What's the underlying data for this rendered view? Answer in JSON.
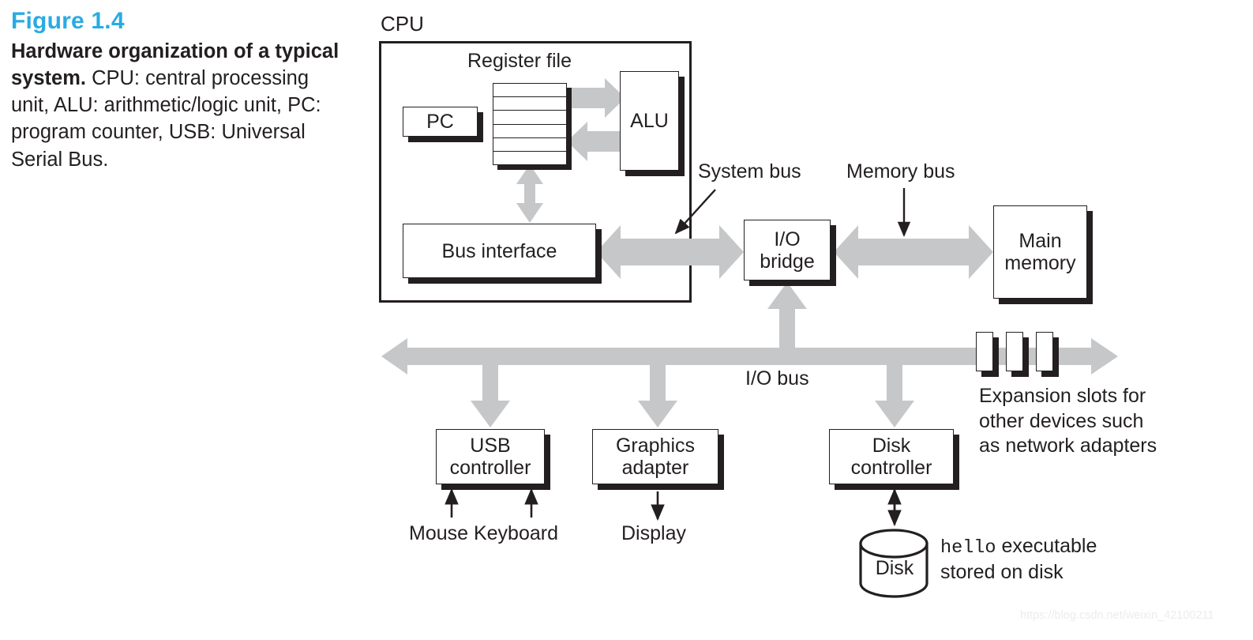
{
  "caption": {
    "figure_number": "Figure 1.4",
    "title": "Hardware organization of a typical system.",
    "title_line1": "Hardware organization",
    "title_line2": "of a typical system.",
    "body_rest": " CPU: central processing unit, ALU: arithmetic/logic unit, PC: program counter, USB: Universal Serial Bus.",
    "accent_color": "#29ABE2",
    "text_color": "#231f20"
  },
  "diagram": {
    "cpu_label": "CPU",
    "register_file_label": "Register file",
    "register_file_rows": 6,
    "blocks": {
      "pc": "PC",
      "alu": "ALU",
      "bus_interface": "Bus interface",
      "io_bridge_line1": "I/O",
      "io_bridge_line2": "bridge",
      "main_memory_line1": "Main",
      "main_memory_line2": "memory",
      "usb_controller_line1": "USB",
      "usb_controller_line2": "controller",
      "graphics_adapter_line1": "Graphics",
      "graphics_adapter_line2": "adapter",
      "disk_controller_line1": "Disk",
      "disk_controller_line2": "controller",
      "disk": "Disk"
    },
    "bus_labels": {
      "system_bus": "System bus",
      "memory_bus": "Memory bus",
      "io_bus": "I/O bus"
    },
    "peripherals": {
      "mouse_keyboard": "Mouse Keyboard",
      "display": "Display"
    },
    "expansion": {
      "line1": "Expansion slots for",
      "line2": "other devices such",
      "line3": "as network adapters",
      "slot_count": 3
    },
    "disk_note": {
      "mono_word": "hello",
      "rest_line1": " executable",
      "line2": "stored on disk"
    },
    "colors": {
      "bus_grey": "#c6c7c9",
      "line_black": "#231f20",
      "box_fill": "#ffffff"
    }
  },
  "watermark": {
    "text": "https://blog.csdn.net/weixin_42100211"
  }
}
